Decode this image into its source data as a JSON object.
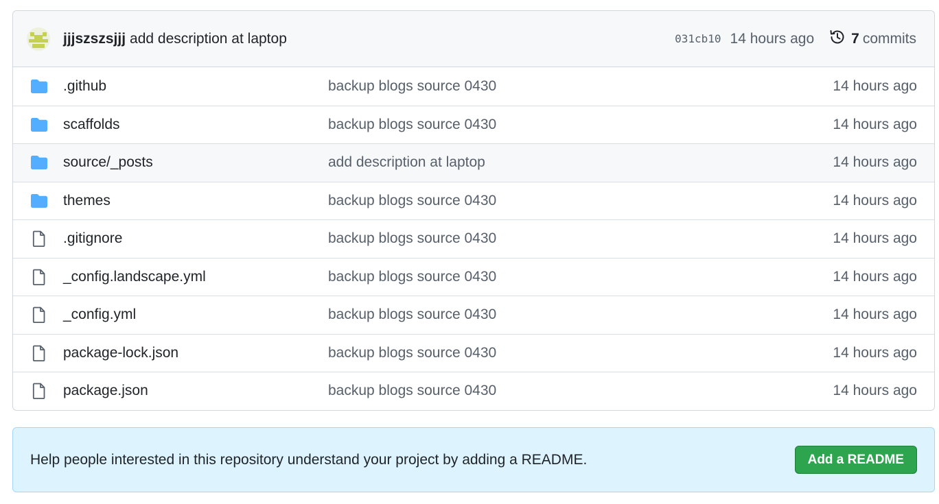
{
  "latest_commit": {
    "author": "jjjszszsjjj",
    "message": "add description at laptop",
    "sha": "031cb10",
    "time": "14 hours ago",
    "commit_count": "7",
    "commit_word": "commits"
  },
  "files": [
    {
      "type": "folder",
      "name": ".github",
      "commit": "backup blogs source 0430",
      "age": "14 hours ago"
    },
    {
      "type": "folder",
      "name": "scaffolds",
      "commit": "backup blogs source 0430",
      "age": "14 hours ago"
    },
    {
      "type": "folder",
      "name": "source/_posts",
      "commit": "add description at laptop",
      "age": "14 hours ago"
    },
    {
      "type": "folder",
      "name": "themes",
      "commit": "backup blogs source 0430",
      "age": "14 hours ago"
    },
    {
      "type": "file",
      "name": ".gitignore",
      "commit": "backup blogs source 0430",
      "age": "14 hours ago"
    },
    {
      "type": "file",
      "name": "_config.landscape.yml",
      "commit": "backup blogs source 0430",
      "age": "14 hours ago"
    },
    {
      "type": "file",
      "name": "_config.yml",
      "commit": "backup blogs source 0430",
      "age": "14 hours ago"
    },
    {
      "type": "file",
      "name": "package-lock.json",
      "commit": "backup blogs source 0430",
      "age": "14 hours ago"
    },
    {
      "type": "file",
      "name": "package.json",
      "commit": "backup blogs source 0430",
      "age": "14 hours ago"
    }
  ],
  "readme_banner": {
    "text": "Help people interested in this repository understand your project by adding a README.",
    "button_label": "Add a README"
  },
  "colors": {
    "folder": "#54aeff",
    "file_icon": "#57606a",
    "button": "#2da44e",
    "banner_bg": "#ddf4ff"
  },
  "icons": {
    "folder": "folder-icon",
    "file": "file-icon",
    "history": "history-icon"
  }
}
